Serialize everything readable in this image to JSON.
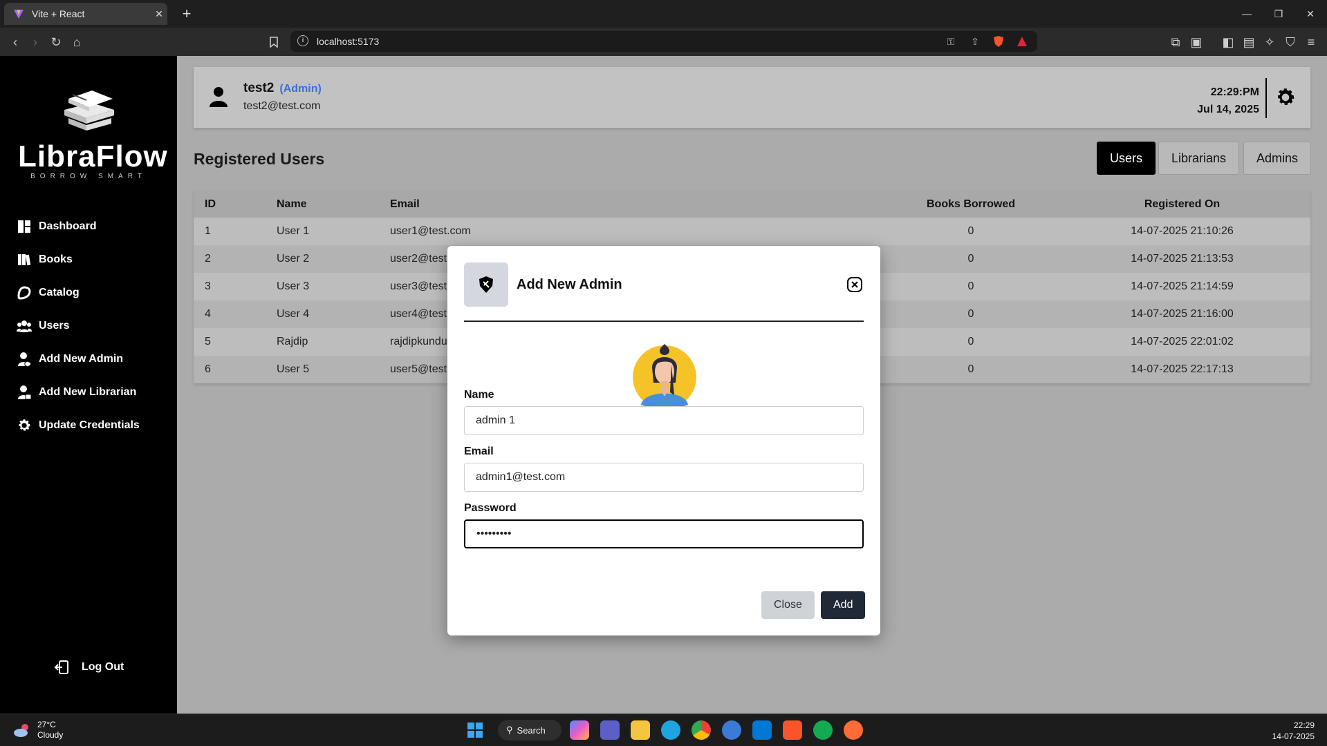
{
  "browser": {
    "tab_title": "Vite + React",
    "url": "localhost:5173"
  },
  "sidebar": {
    "logo_name": "LibraFlow",
    "logo_tagline": "BORROW SMART",
    "items": [
      {
        "label": "Dashboard",
        "icon": "dashboard-icon"
      },
      {
        "label": "Books",
        "icon": "books-icon"
      },
      {
        "label": "Catalog",
        "icon": "catalog-icon"
      },
      {
        "label": "Users",
        "icon": "users-icon"
      },
      {
        "label": "Add New Admin",
        "icon": "add-admin-icon"
      },
      {
        "label": "Add New Librarian",
        "icon": "add-librarian-icon"
      },
      {
        "label": "Update Credentials",
        "icon": "gear-icon"
      }
    ],
    "logout_label": "Log Out"
  },
  "header": {
    "user_name": "test2",
    "user_role": "(Admin)",
    "user_email": "test2@test.com",
    "time": "22:29:PM",
    "date": "Jul 14, 2025"
  },
  "main": {
    "title": "Registered Users",
    "toggles": [
      "Users",
      "Librarians",
      "Admins"
    ],
    "active_toggle": "Users",
    "table": {
      "columns": [
        "ID",
        "Name",
        "Email",
        "Books Borrowed",
        "Registered On"
      ],
      "rows": [
        {
          "id": "1",
          "name": "User 1",
          "email": "user1@test.com",
          "borrowed": "0",
          "registered": "14-07-2025 21:10:26"
        },
        {
          "id": "2",
          "name": "User 2",
          "email": "user2@test.com",
          "borrowed": "0",
          "registered": "14-07-2025 21:13:53"
        },
        {
          "id": "3",
          "name": "User 3",
          "email": "user3@test.com",
          "borrowed": "0",
          "registered": "14-07-2025 21:14:59"
        },
        {
          "id": "4",
          "name": "User 4",
          "email": "user4@test.com",
          "borrowed": "0",
          "registered": "14-07-2025 21:16:00"
        },
        {
          "id": "5",
          "name": "Rajdip",
          "email": "rajdipkundu",
          "borrowed": "0",
          "registered": "14-07-2025 22:01:02"
        },
        {
          "id": "6",
          "name": "User 5",
          "email": "user5@test.com",
          "borrowed": "0",
          "registered": "14-07-2025 22:17:13"
        }
      ]
    }
  },
  "modal": {
    "title": "Add New Admin",
    "name_label": "Name",
    "name_value": "admin 1",
    "email_label": "Email",
    "email_value": "admin1@test.com",
    "password_label": "Password",
    "password_value": "•••••••••",
    "close_label": "Close",
    "add_label": "Add"
  },
  "taskbar": {
    "temperature": "27°C",
    "weather": "Cloudy",
    "search_label": "Search",
    "time": "22:29",
    "date": "14-07-2025"
  },
  "colors": {
    "accent_role": "#3b6fd8",
    "add_button": "#1f2937",
    "sidebar_bg": "#000000"
  }
}
